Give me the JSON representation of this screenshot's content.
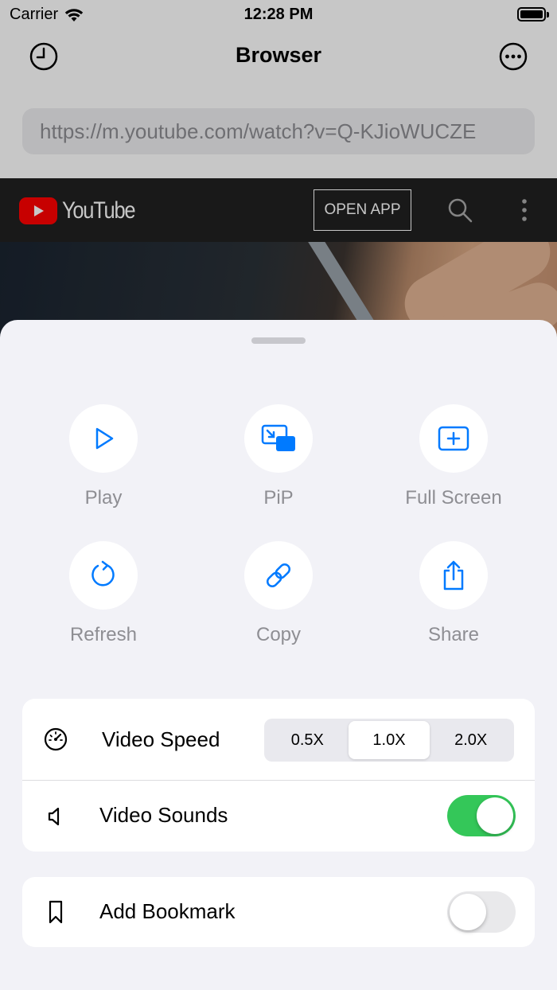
{
  "status": {
    "carrier": "Carrier",
    "time": "12:28 PM"
  },
  "nav": {
    "title": "Browser",
    "url": "https://m.youtube.com/watch?v=Q-KJioWUCZE"
  },
  "youtube": {
    "wordmark": "YouTube",
    "open_app": "OPEN APP"
  },
  "actions": [
    {
      "label": "Play",
      "icon": "play-icon"
    },
    {
      "label": "PiP",
      "icon": "pip-icon"
    },
    {
      "label": "Full Screen",
      "icon": "full-screen-icon"
    },
    {
      "label": "Refresh",
      "icon": "refresh-icon"
    },
    {
      "label": "Copy",
      "icon": "link-icon"
    },
    {
      "label": "Share",
      "icon": "share-icon"
    }
  ],
  "settings": {
    "speed": {
      "label": "Video Speed",
      "options": [
        "0.5X",
        "1.0X",
        "2.0X"
      ],
      "selected": "1.0X"
    },
    "sounds": {
      "label": "Video Sounds",
      "enabled": true
    },
    "bookmark": {
      "label": "Add Bookmark",
      "enabled": false
    }
  },
  "colors": {
    "accent": "#007aff",
    "toggle_on": "#34c759",
    "toggle_off": "#e9e9eb",
    "yt_red": "#ff0000"
  }
}
